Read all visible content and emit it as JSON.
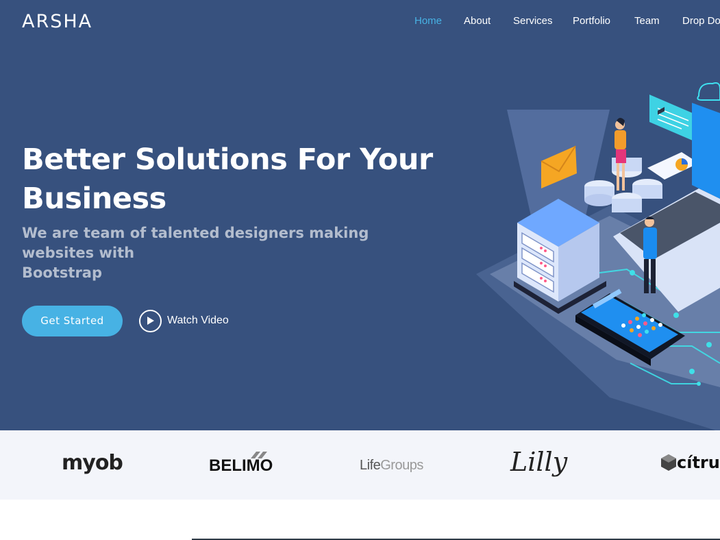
{
  "brand": {
    "logo": "ARSHA"
  },
  "nav": {
    "items": [
      {
        "label": "Home",
        "active": true
      },
      {
        "label": "About",
        "active": false
      },
      {
        "label": "Services",
        "active": false
      },
      {
        "label": "Portfolio",
        "active": false
      },
      {
        "label": "Team",
        "active": false
      },
      {
        "label": "Drop Do",
        "active": false
      }
    ]
  },
  "hero": {
    "title_line1": "Better Solutions For Your",
    "title_line2": "Business",
    "subtitle_line1": "We are team of talented designers making websites with",
    "subtitle_line2": "Bootstrap",
    "cta_label": "Get Started",
    "video_label": "Watch Video",
    "illustration_icon": "isometric-tech-illustration"
  },
  "clients": {
    "logos": [
      {
        "name": "myob"
      },
      {
        "name": "BELIMO"
      },
      {
        "name": "LifeGroups",
        "part1": "Life",
        "part2": "Groups"
      },
      {
        "name": "Lilly"
      },
      {
        "name": "citrus",
        "display": "cítrus"
      }
    ]
  },
  "colors": {
    "hero_bg": "#37517e",
    "accent": "#47b2e4",
    "clients_bg": "#f3f5fa"
  }
}
